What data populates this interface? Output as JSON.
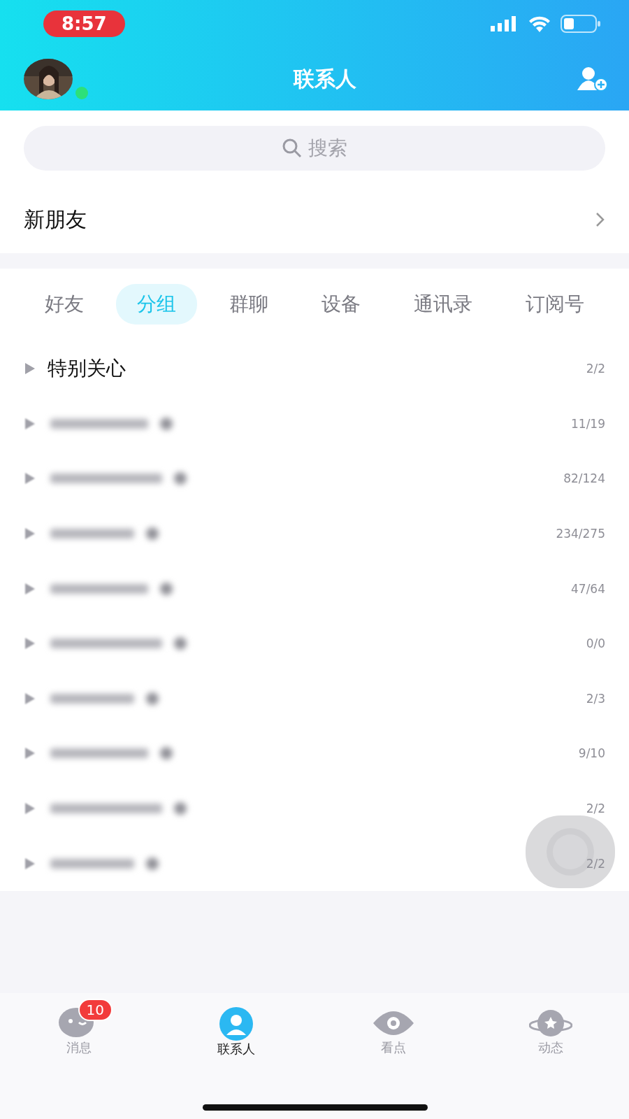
{
  "status_bar": {
    "time": "8:57"
  },
  "header": {
    "title": "联系人",
    "online": true
  },
  "search": {
    "placeholder": "搜索"
  },
  "new_friends": {
    "label": "新朋友"
  },
  "tabs": [
    {
      "label": "好友",
      "selected": false
    },
    {
      "label": "分组",
      "selected": true
    },
    {
      "label": "群聊",
      "selected": false
    },
    {
      "label": "设备",
      "selected": false
    },
    {
      "label": "通讯录",
      "selected": false
    },
    {
      "label": "订阅号",
      "selected": false
    }
  ],
  "groups": [
    {
      "kind": "named",
      "name": "特别关心",
      "count": "2/2"
    },
    {
      "kind": "blurred",
      "count": "11/19"
    },
    {
      "kind": "blurred",
      "count": "82/124"
    },
    {
      "kind": "blurred",
      "count": "234/275"
    },
    {
      "kind": "blurred",
      "count": "47/64"
    },
    {
      "kind": "blurred",
      "count": "0/0"
    },
    {
      "kind": "blurred",
      "count": "2/3"
    },
    {
      "kind": "blurred",
      "count": "9/10"
    },
    {
      "kind": "blurred",
      "count": "2/2"
    },
    {
      "kind": "blurred",
      "count": "2/2"
    }
  ],
  "bottom_nav": [
    {
      "kind": "messages",
      "label": "消息",
      "badge": "10",
      "selected": false
    },
    {
      "kind": "contacts",
      "label": "联系人",
      "selected": true
    },
    {
      "kind": "watch",
      "label": "看点",
      "selected": false
    },
    {
      "kind": "feed",
      "label": "动态",
      "selected": false
    }
  ]
}
